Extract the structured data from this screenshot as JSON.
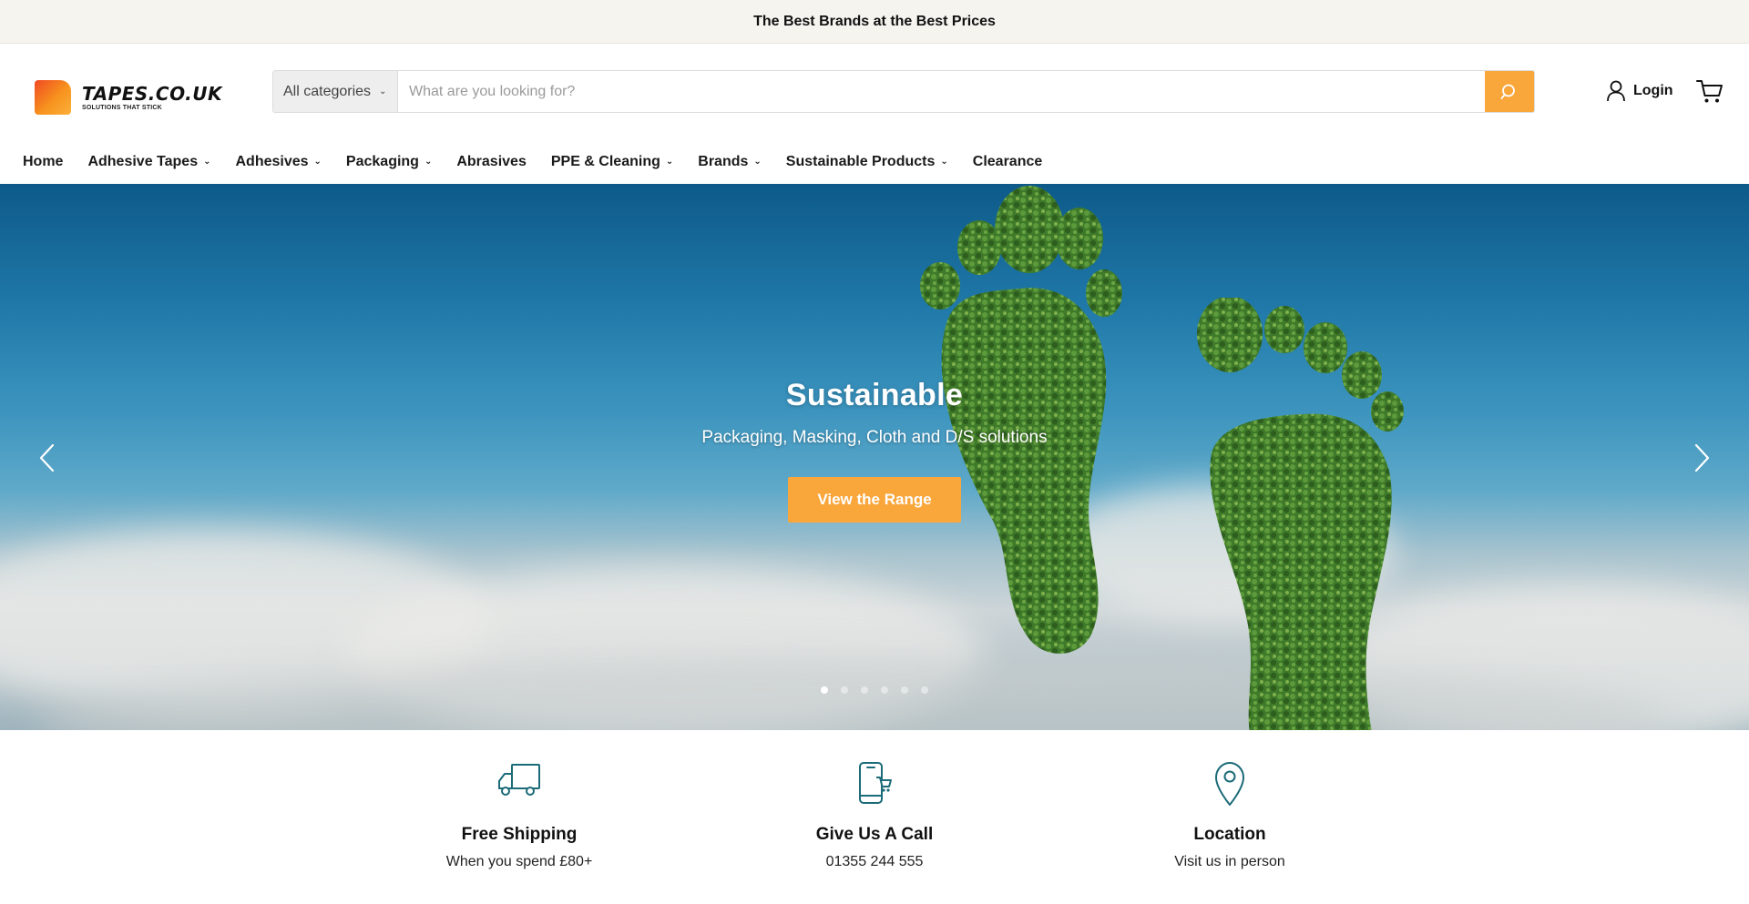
{
  "announcement": "The Best Brands at the Best Prices",
  "logo": {
    "title": "TAPES.CO.UK",
    "tagline": "SOLUTIONS THAT STICK"
  },
  "search": {
    "category": "All categories",
    "placeholder": "What are you looking for?",
    "value": ""
  },
  "account": {
    "login_label": "Login"
  },
  "nav": {
    "items": [
      {
        "label": "Home",
        "dropdown": false
      },
      {
        "label": "Adhesive Tapes",
        "dropdown": true
      },
      {
        "label": "Adhesives",
        "dropdown": true
      },
      {
        "label": "Packaging",
        "dropdown": true
      },
      {
        "label": "Abrasives",
        "dropdown": false
      },
      {
        "label": "PPE & Cleaning",
        "dropdown": true
      },
      {
        "label": "Brands",
        "dropdown": true
      },
      {
        "label": "Sustainable Products",
        "dropdown": true
      },
      {
        "label": "Clearance",
        "dropdown": false
      }
    ]
  },
  "hero": {
    "title": "Sustainable",
    "subtitle": "Packaging, Masking, Cloth and D/S solutions",
    "button_label": "View the Range",
    "slide_count": 6,
    "active_slide": 1
  },
  "features": [
    {
      "icon": "truck-icon",
      "title": "Free Shipping",
      "subtitle": "When you spend £80+"
    },
    {
      "icon": "phone-cart-icon",
      "title": "Give Us A Call",
      "subtitle": "01355 244 555"
    },
    {
      "icon": "map-pin-icon",
      "title": "Location",
      "subtitle": "Visit us in person"
    }
  ],
  "colors": {
    "accent": "#f9a63b",
    "icon_teal": "#1c6b78",
    "announcement_bg": "#f5f4ef"
  }
}
